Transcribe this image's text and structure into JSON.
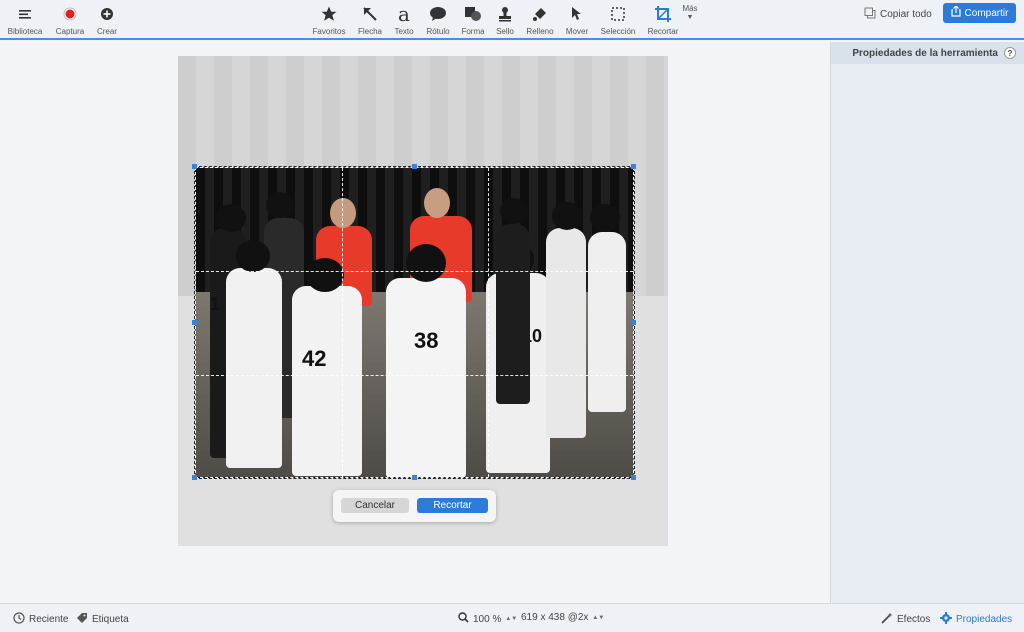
{
  "toolbar": {
    "left": [
      {
        "label": "Biblioteca",
        "icon": "menu-icon"
      },
      {
        "label": "Captura",
        "icon": "record-icon"
      },
      {
        "label": "Crear",
        "icon": "plus-circle-icon"
      }
    ],
    "tools": [
      {
        "label": "Favoritos",
        "icon": "star-icon"
      },
      {
        "label": "Flecha",
        "icon": "arrow-icon"
      },
      {
        "label": "Texto",
        "icon": "text-icon"
      },
      {
        "label": "Rótulo",
        "icon": "speech-bubble-icon"
      },
      {
        "label": "Forma",
        "icon": "shape-icon"
      },
      {
        "label": "Sello",
        "icon": "stamp-icon"
      },
      {
        "label": "Relleno",
        "icon": "fill-icon"
      },
      {
        "label": "Mover",
        "icon": "move-icon"
      },
      {
        "label": "Selección",
        "icon": "selection-icon"
      },
      {
        "label": "Recortar",
        "icon": "crop-icon"
      }
    ],
    "more_label": "Más",
    "copy_all": "Copiar todo",
    "share": "Compartir"
  },
  "crop_dialog": {
    "cancel": "Cancelar",
    "crop": "Recortar"
  },
  "photo": {
    "jersey_numbers": [
      "38",
      "42",
      "10",
      "1"
    ]
  },
  "properties": {
    "title": "Propiedades de la herramienta",
    "help": "?"
  },
  "status": {
    "recent": "Reciente",
    "tag": "Etiqueta",
    "zoom": "100 %",
    "dimensions": "619 x 438 @2x",
    "effects": "Efectos",
    "properties": "Propiedades"
  },
  "colors": {
    "accent": "#2c7bd8",
    "record": "#e02020",
    "selected_tool": "#2c7bd8"
  }
}
